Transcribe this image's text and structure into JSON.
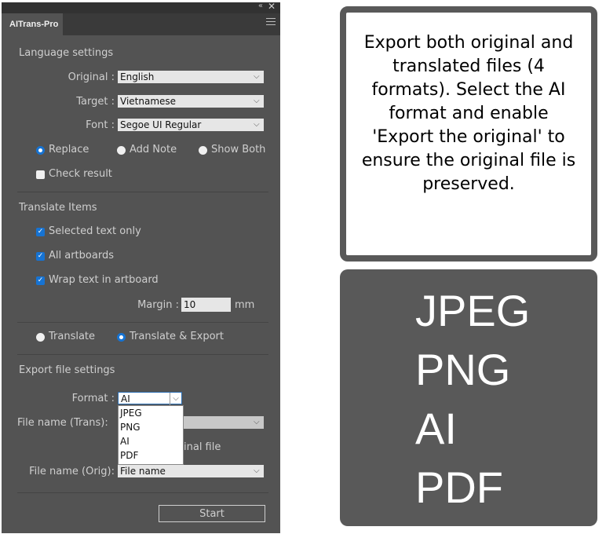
{
  "panel": {
    "tab_title": "AITrans-Pro",
    "language_settings": {
      "title": "Language settings",
      "original_label": "Original :",
      "original_value": "English",
      "target_label": "Target :",
      "target_value": "Vietnamese",
      "font_label": "Font :",
      "font_value": "Segoe UI Regular",
      "mode_options": [
        "Replace",
        "Add Note",
        "Show Both"
      ],
      "mode_selected": "Replace",
      "check_result_label": "Check result",
      "check_result_checked": false
    },
    "translate_items": {
      "title": "Translate Items",
      "selected_text_label": "Selected text only",
      "all_artboards_label": "All artboards",
      "wrap_text_label": "Wrap text in artboard",
      "margin_label": "Margin :",
      "margin_value": "10",
      "margin_unit": "mm"
    },
    "action": {
      "options": [
        "Translate",
        "Translate & Export"
      ],
      "selected": "Translate & Export"
    },
    "export_settings": {
      "title": "Export file settings",
      "format_label": "Format :",
      "format_value": "AI",
      "format_options": [
        "JPEG",
        "PNG",
        "AI",
        "PDF"
      ],
      "file_name_trans_label": "File name (Trans):",
      "export_original_partial": "inal file",
      "file_name_orig_label": "File name (Orig):",
      "file_name_orig_value": "File name"
    },
    "start_label": "Start"
  },
  "callout": {
    "text": "Export both original and translated files (4 formats). Select the AI format and enable 'Export the original' to ensure the original file is preserved.",
    "formats": [
      "JPEG",
      "PNG",
      "AI",
      "PDF"
    ]
  },
  "colors": {
    "panel_bg": "#535353",
    "accent": "#1673d3",
    "callout_border": "#595959"
  }
}
